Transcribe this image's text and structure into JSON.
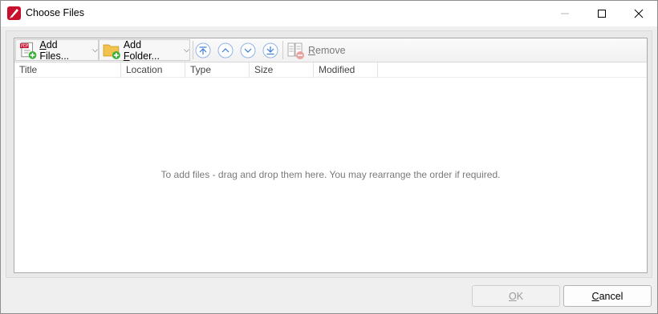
{
  "window": {
    "title": "Choose Files"
  },
  "toolbar": {
    "add_files": {
      "underlined": "A",
      "rest": "dd Files..."
    },
    "add_folder": {
      "underlined": "F",
      "prefix": "Add ",
      "rest": "older..."
    },
    "remove": {
      "underlined": "R",
      "rest": "emove"
    },
    "nav_icons": [
      "move-to-top-icon",
      "move-up-icon",
      "move-down-icon",
      "move-to-bottom-icon"
    ]
  },
  "columns": [
    "Title",
    "Location",
    "Type",
    "Size",
    "Modified"
  ],
  "list": {
    "empty_message": "To add files - drag and drop them here. You may rearrange the order if required."
  },
  "buttons": {
    "ok": {
      "underlined": "O",
      "rest": "K",
      "enabled": false
    },
    "cancel": {
      "underlined": "C",
      "rest": "ancel"
    }
  },
  "colors": {
    "nav_icon": "#3a7bd5",
    "app_icon": "#c8102e",
    "add_badge": "#3cae3c",
    "folder": "#f2c14e"
  }
}
